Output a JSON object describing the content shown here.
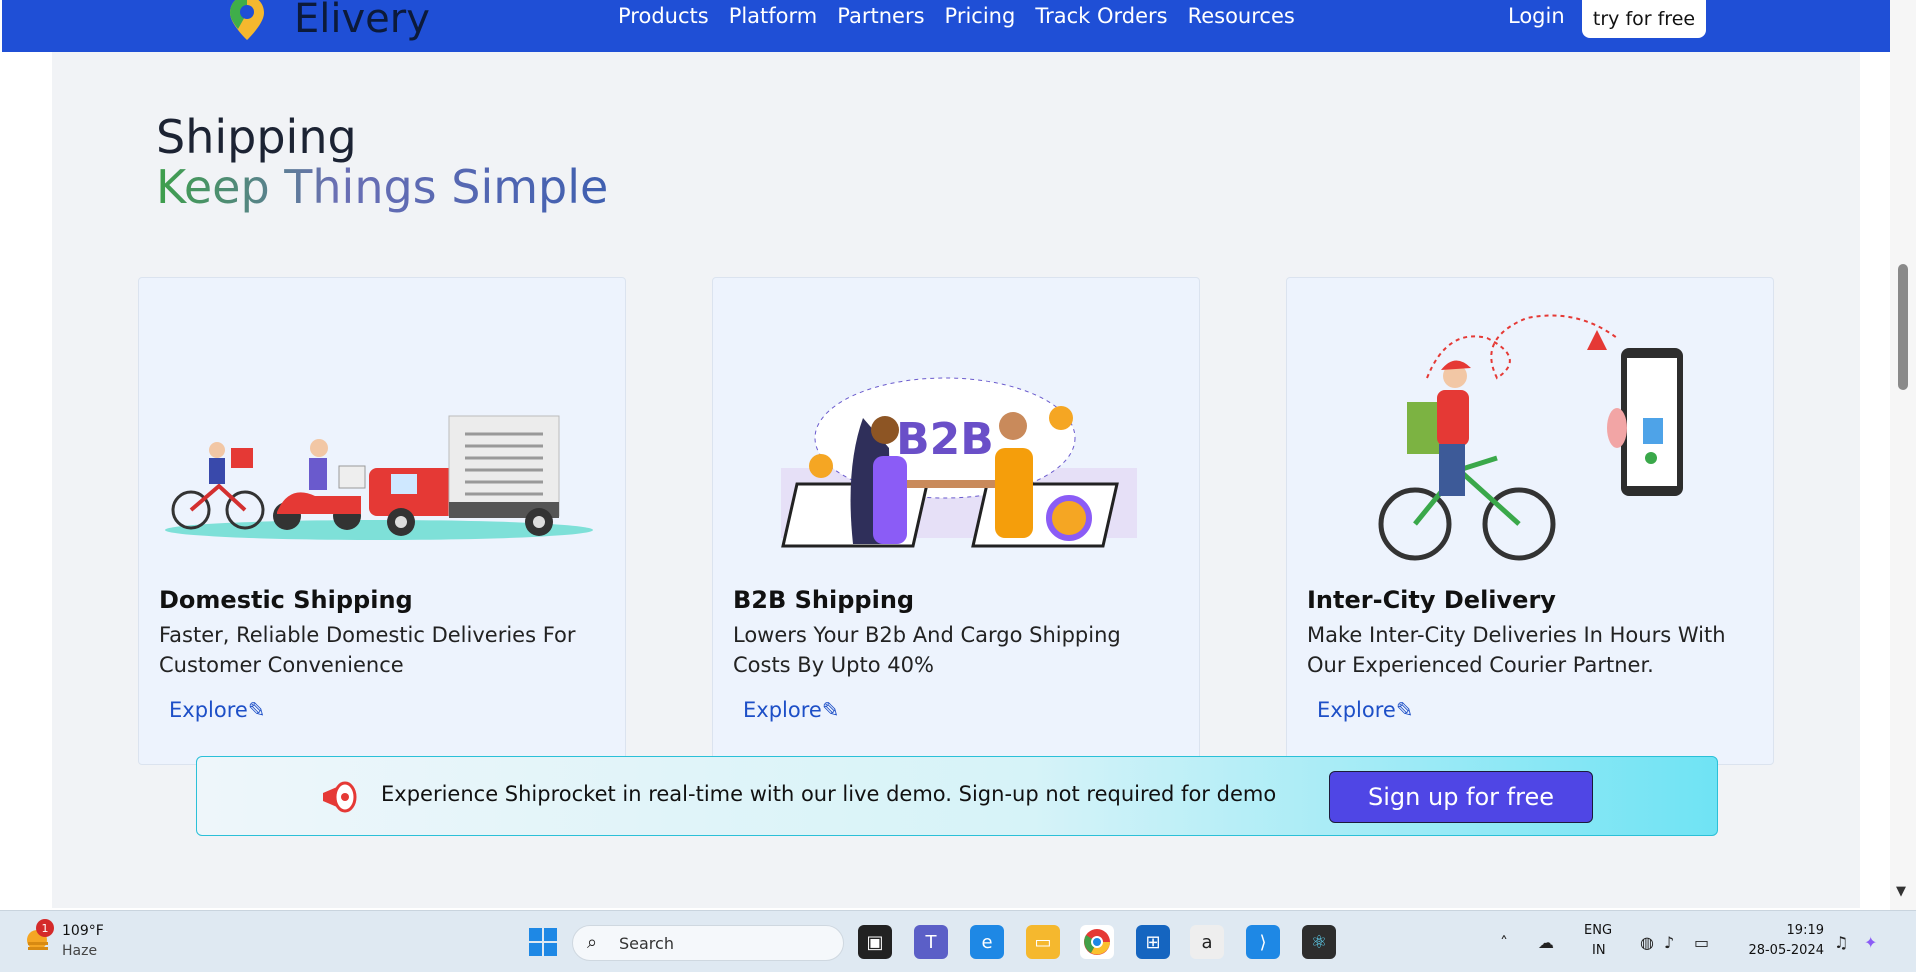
{
  "nav": {
    "brand": "Elivery",
    "links": [
      "Products",
      "Platform",
      "Partners",
      "Pricing",
      "Track Orders",
      "Resources"
    ],
    "login": "Login",
    "try_free": "try for free"
  },
  "section": {
    "heading": "Shipping",
    "subheading": "Keep Things Simple"
  },
  "cards": [
    {
      "title": "Domestic Shipping",
      "desc": "Faster, Reliable Domestic Deliveries For Customer Convenience",
      "link": "Explore"
    },
    {
      "title": "B2B Shipping",
      "desc": "Lowers Your B2b And Cargo Shipping Costs By Upto 40%",
      "link": "Explore",
      "illus_text": "B2B"
    },
    {
      "title": "Inter-City Delivery",
      "desc": "Make Inter-City Deliveries In Hours With Our Experienced Courier Partner.",
      "link": "Explore"
    }
  ],
  "banner": {
    "text": "Experience Shiprocket in real-time with our live demo. Sign-up not required for demo",
    "button": "Sign up for free"
  },
  "taskbar": {
    "weather_temp": "109°F",
    "weather_cond": "Haze",
    "weather_badge": "1",
    "search_placeholder": "Search",
    "lang_line1": "ENG",
    "lang_line2": "IN",
    "time": "19:19",
    "date": "28-05-2024"
  },
  "colors": {
    "nav_bg": "#1f4fd6",
    "page_bg": "#f1f3f6",
    "card_bg": "#edf3fd",
    "link": "#1d4fc7",
    "signup_bg": "#4f46e5"
  }
}
